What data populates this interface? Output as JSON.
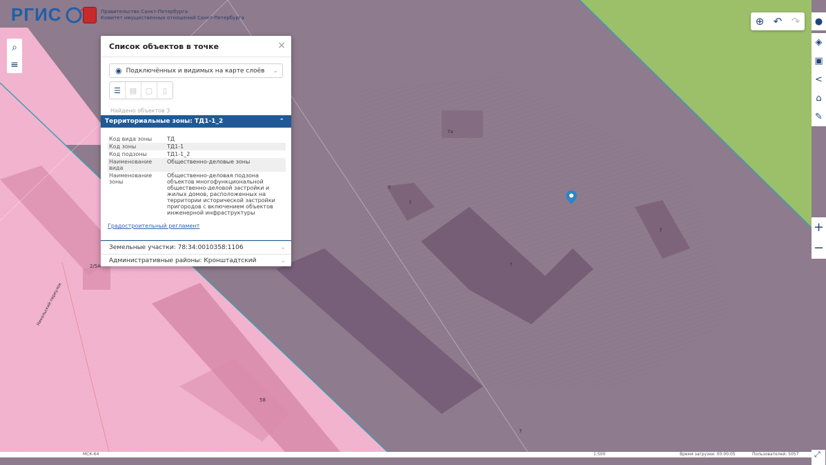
{
  "header": {
    "logo_text": "РГИС",
    "gov_line1": "Правительство Санкт-Петербурга",
    "gov_line2": "Комитет имущественных отношений Санкт-Петербурга"
  },
  "popup": {
    "title": "Список объектов в точке",
    "close_glyph": "×",
    "layer_select": "Подключённых и видимых на карте слоёв",
    "found_count": "Найдено объектов 3",
    "sections": [
      {
        "title": "Территориальные зоны: ТД1-1_2",
        "expanded": true,
        "attributes": [
          {
            "key": "Код вида зоны",
            "value": "ТД"
          },
          {
            "key": "Код зоны",
            "value": "ТД1-1"
          },
          {
            "key": "Код подзоны",
            "value": "ТД1-1_2"
          },
          {
            "key": "Наименование вида",
            "value": "Общественно-деловые зоны"
          },
          {
            "key": "Наименование зоны",
            "value": "Общественно-деловая подзона объектов многофункциональной общественно-деловой застройки и жилых домов, расположенных на территории исторической застройки пригородов с включением объектов инженерной инфраструктуры"
          }
        ],
        "link": "Градостроительный регламент"
      },
      {
        "title": "Земельные участки: 78:34:0010358:1106",
        "expanded": false
      },
      {
        "title": "Административные районы: Кронштадтский",
        "expanded": false
      }
    ]
  },
  "map_labels": {
    "l1": "7а",
    "l2": "7",
    "l3": "7",
    "l4": "7",
    "l5": "7",
    "l6": "58",
    "l7": "7",
    "l8": "2/5А",
    "street": "Никольский переулок"
  },
  "status_bar": {
    "coords": "МСК-64",
    "scale": "1:500",
    "time": "Время загрузки: 00:00:05",
    "users": "Пользователей: 5057"
  },
  "colors": {
    "purple_zone": "#8e7b8d",
    "pink_zone": "#f2b3cf",
    "green_zone": "#9cbf6a",
    "accent": "#1f5a96"
  }
}
